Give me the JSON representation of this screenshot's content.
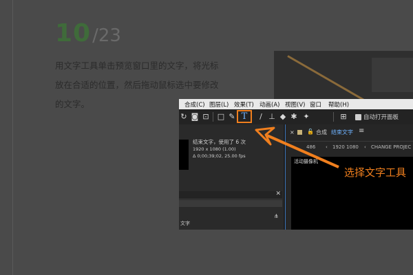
{
  "step": {
    "current": "10",
    "total": "/23"
  },
  "description": [
    "用文字工具单击预览窗口里的文字，将光标",
    "放在合适的位置，然后拖动鼠标选中要修改",
    "的文字。"
  ],
  "menubar": {
    "items": [
      "合成(C)",
      "图层(L)",
      "效果(T)",
      "动画(A)",
      "视图(V)",
      "窗口",
      "帮助(H)"
    ]
  },
  "toolbar": {
    "auto_open_panel": "自动打开面板",
    "text_tool_glyph": "T"
  },
  "project_panel": {
    "comp_name": "结束文字",
    "comp_usage": "，使用了 6 次",
    "resolution": "1920 x 1080 (1.00)",
    "duration": "Δ 0;00;39;02, 25.00 fps",
    "bottom_label": "文字"
  },
  "composition_panel": {
    "tab_prefix": "合成",
    "tab_active": "结束文字",
    "breadcrumbs": [
      "486",
      "1920 1080",
      "CHANGE PROJEC"
    ],
    "viewer_label": "活动摄像机"
  },
  "callout": {
    "label": "选择文字工具",
    "color": "#f07f1e"
  }
}
